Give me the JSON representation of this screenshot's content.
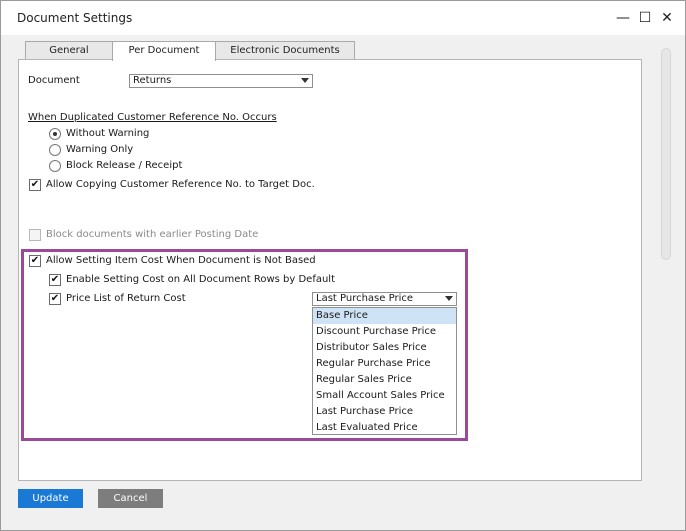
{
  "window": {
    "title": "Document Settings",
    "minimize_glyph": "—",
    "maximize_glyph": "☐",
    "close_glyph": "✕"
  },
  "tabs": [
    {
      "label": "General",
      "active": false
    },
    {
      "label": "Per Document",
      "active": true
    },
    {
      "label": "Electronic Documents",
      "active": false
    }
  ],
  "document": {
    "label": "Document",
    "value": "Returns"
  },
  "duplicated_ref": {
    "heading": "When Duplicated Customer Reference No. Occurs",
    "options": [
      {
        "label": "Without Warning",
        "checked": true
      },
      {
        "label": "Warning Only",
        "checked": false
      },
      {
        "label": "Block Release / Receipt",
        "checked": false
      }
    ]
  },
  "allow_copying": {
    "label": "Allow Copying Customer Reference No. to Target Doc.",
    "checked": true
  },
  "block_documents": {
    "label": "Block documents with earlier Posting Date",
    "checked": false,
    "enabled": false
  },
  "item_cost": {
    "allow_label": "Allow Setting Item Cost When Document is Not Based",
    "allow_checked": true,
    "enable_rows_label": "Enable Setting Cost on All Document Rows by Default",
    "enable_rows_checked": true,
    "price_list_label": "Price List of Return Cost",
    "price_list_checked": true,
    "price_list_value": "Last Purchase Price",
    "price_list_options": [
      "Base Price",
      "Discount Purchase Price",
      "Distributor Sales Price",
      "Regular Purchase Price",
      "Regular Sales Price",
      "Small Account Sales Price",
      "Last Purchase Price",
      "Last Evaluated Price"
    ],
    "highlighted_option": "Base Price"
  },
  "buttons": {
    "update_label": "Update",
    "cancel_label": "Cancel"
  },
  "colors": {
    "highlight_border": "#9b4a9b",
    "update_button": "#1a79d4",
    "cancel_button": "#7d7d7d",
    "selected_option": "#cfe3f6"
  },
  "icons": {
    "check": "✔"
  }
}
